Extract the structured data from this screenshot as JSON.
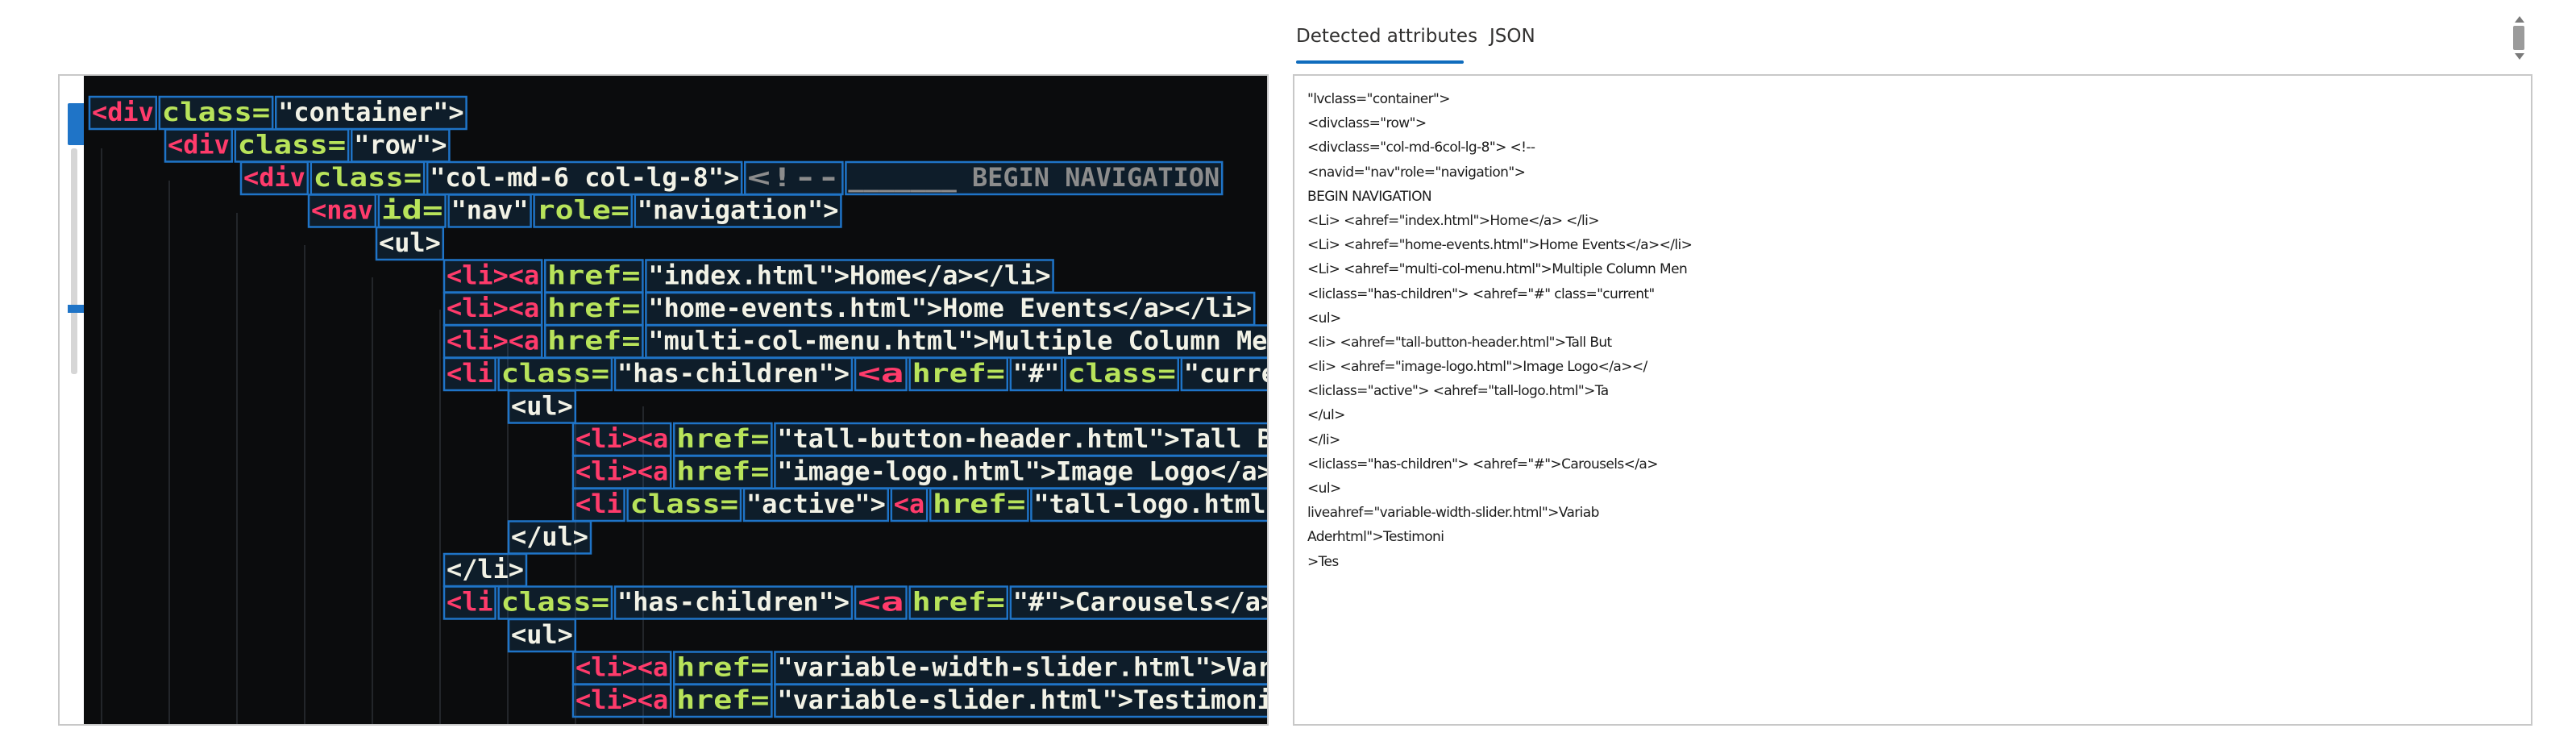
{
  "tabs": [
    {
      "label": "Detected attributes",
      "active": true
    },
    {
      "label": "JSON",
      "active": false
    }
  ],
  "colors": {
    "accent": "#0f6cbd",
    "box": "#1f74c7",
    "code_background": "#0b0c0d",
    "tag": "#ff3b6b",
    "attribute": "#b8e35a",
    "string": "#f2f2e6",
    "comment": "#8c8c8c"
  },
  "code_image": {
    "lines": [
      [
        {
          "t": "<div",
          "c": "tag"
        },
        {
          "t": " class=",
          "c": "attr"
        },
        {
          "t": "\"container\">",
          "c": "str"
        }
      ],
      [
        {
          "t": "<div",
          "c": "tag"
        },
        {
          "t": " class=",
          "c": "attr"
        },
        {
          "t": "\"row\">",
          "c": "str"
        }
      ],
      [
        {
          "t": "<div",
          "c": "tag"
        },
        {
          "t": " class=",
          "c": "attr"
        },
        {
          "t": "\"col-md-6 col-lg-8\">",
          "c": "str"
        },
        {
          "t": " <!-- ",
          "c": "cmt"
        },
        {
          "t": "_______ BEGIN NAVIGATION",
          "c": "cmt"
        }
      ],
      [
        {
          "t": "<nav",
          "c": "tag"
        },
        {
          "t": " id=",
          "c": "attr"
        },
        {
          "t": "\"nav\"",
          "c": "str"
        },
        {
          "t": " role=",
          "c": "attr"
        },
        {
          "t": "\"navigation\">",
          "c": "str"
        }
      ],
      [
        {
          "t": "<ul>",
          "c": "str"
        }
      ],
      [
        {
          "t": "<li><a",
          "c": "tag"
        },
        {
          "t": " href=",
          "c": "attr"
        },
        {
          "t": "\"index.html\">Home</a></li>",
          "c": "str"
        }
      ],
      [
        {
          "t": "<li><a",
          "c": "tag"
        },
        {
          "t": " href=",
          "c": "attr"
        },
        {
          "t": "\"home-events.html\">Home Events</a></li>",
          "c": "str"
        }
      ],
      [
        {
          "t": "<li><a",
          "c": "tag"
        },
        {
          "t": " href=",
          "c": "attr"
        },
        {
          "t": "\"multi-col-menu.html\">Multiple Column Menu",
          "c": "str"
        }
      ],
      [
        {
          "t": "<li",
          "c": "tag"
        },
        {
          "t": " class=",
          "c": "attr"
        },
        {
          "t": "\"has-children\">",
          "c": "str"
        },
        {
          "t": " <a",
          "c": "tag"
        },
        {
          "t": " href=",
          "c": "attr"
        },
        {
          "t": "\"#\"",
          "c": "str"
        },
        {
          "t": " class=",
          "c": "attr"
        },
        {
          "t": "\"current\">",
          "c": "str"
        }
      ],
      [
        {
          "t": "<ul>",
          "c": "str"
        }
      ],
      [
        {
          "t": "<li><a",
          "c": "tag"
        },
        {
          "t": " href=",
          "c": "attr"
        },
        {
          "t": "\"tall-button-header.html\">Tall Button",
          "c": "str"
        }
      ],
      [
        {
          "t": "<li><a",
          "c": "tag"
        },
        {
          "t": " href=",
          "c": "attr"
        },
        {
          "t": "\"image-logo.html\">Image Logo</a></li>",
          "c": "str"
        }
      ],
      [
        {
          "t": "<li",
          "c": "tag"
        },
        {
          "t": " class=",
          "c": "attr"
        },
        {
          "t": "\"active\">",
          "c": "str"
        },
        {
          "t": "<a",
          "c": "tag"
        },
        {
          "t": " href=",
          "c": "attr"
        },
        {
          "t": "\"tall-logo.html\">Tall",
          "c": "str"
        }
      ],
      [
        {
          "t": "</ul>",
          "c": "str"
        }
      ],
      [
        {
          "t": "</li>",
          "c": "str"
        }
      ],
      [
        {
          "t": "<li",
          "c": "tag"
        },
        {
          "t": " class=",
          "c": "attr"
        },
        {
          "t": "\"has-children\">",
          "c": "str"
        },
        {
          "t": " <a",
          "c": "tag"
        },
        {
          "t": " href=",
          "c": "attr"
        },
        {
          "t": "\"#\">Carousels</a>",
          "c": "str"
        }
      ],
      [
        {
          "t": "<ul>",
          "c": "str"
        }
      ],
      [
        {
          "t": "<li><a",
          "c": "tag"
        },
        {
          "t": " href=",
          "c": "attr"
        },
        {
          "t": "\"variable-width-slider.html\">Variable",
          "c": "str"
        }
      ],
      [
        {
          "t": "<li><a",
          "c": "tag"
        },
        {
          "t": " href=",
          "c": "attr"
        },
        {
          "t": "\"variable-slider.html\">Testimonials",
          "c": "str"
        }
      ]
    ]
  },
  "detected_attributes": [
    "\"lvclass=\"container\">",
    "<divclass=\"row\">",
    "<divclass=\"col-md-6col-lg-8\"> <!--",
    "<navid=\"nav\"role=\"navigation\">",
    "BEGIN NAVIGATION",
    "<Li> <ahref=\"index.html\">Home</a> </li>",
    "<Li> <ahref=\"home-events.html\">Home Events</a></li>",
    "<Li> <ahref=\"multi-col-menu.html\">Multiple Column Men",
    "<liclass=\"has-children\"> <ahref=\"#\" class=\"current\"",
    "<ul>",
    "<li> <ahref=\"tall-button-header.html\">Tall But",
    "<li> <ahref=\"image-logo.html\">Image Logo</a></",
    "<liclass=\"active\"> <ahref=\"tall-logo.html\">Ta",
    "</ul>",
    "</li>",
    "<liclass=\"has-children\"> <ahref=\"#\">Carousels</a>",
    "<ul>",
    "liveahref=\"variable-width-slider.html\">Variab",
    "Aderhtml\">Testimoni",
    ">Tes"
  ]
}
